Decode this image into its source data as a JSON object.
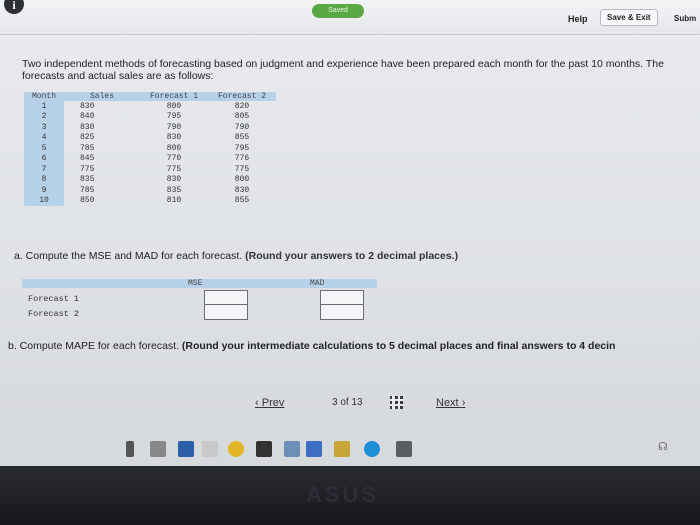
{
  "topbar": {
    "saved": "Saved",
    "help": "Help",
    "save_exit": "Save & Exit",
    "submit": "Subm"
  },
  "intro": "Two independent methods of forecasting based on judgment and experience have been prepared each month for the past 10 months. The forecasts and actual sales are as follows:",
  "data_table": {
    "headers": [
      "Month",
      "Sales",
      "Forecast 1",
      "Forecast 2"
    ],
    "rows": [
      [
        "1",
        "830",
        "800",
        "820"
      ],
      [
        "2",
        "840",
        "795",
        "805"
      ],
      [
        "3",
        "830",
        "790",
        "790"
      ],
      [
        "4",
        "825",
        "830",
        "855"
      ],
      [
        "5",
        "785",
        "800",
        "795"
      ],
      [
        "6",
        "845",
        "770",
        "776"
      ],
      [
        "7",
        "775",
        "775",
        "775"
      ],
      [
        "8",
        "835",
        "830",
        "800"
      ],
      [
        "9",
        "785",
        "835",
        "830"
      ],
      [
        "10",
        "850",
        "810",
        "855"
      ]
    ]
  },
  "question_a": {
    "text": "a. Compute the MSE and MAD for each forecast.",
    "note": "(Round your answers to 2 decimal places.)",
    "col_mse": "MSE",
    "col_mad": "MAD",
    "row_f1": "Forecast 1",
    "row_f2": "Forecast 2"
  },
  "question_b": {
    "text": "b. Compute MAPE for each forecast.",
    "note": "(Round your intermediate calculations to 5 decimal places and final answers to 4 decin"
  },
  "nav": {
    "prev": "Prev",
    "page": "3",
    "of": "of",
    "total": "13",
    "next": "Next"
  },
  "bezel_brand": "ASUS",
  "colors": {
    "table_header": "#b7d1e9",
    "saved_badge": "#5aa845"
  }
}
